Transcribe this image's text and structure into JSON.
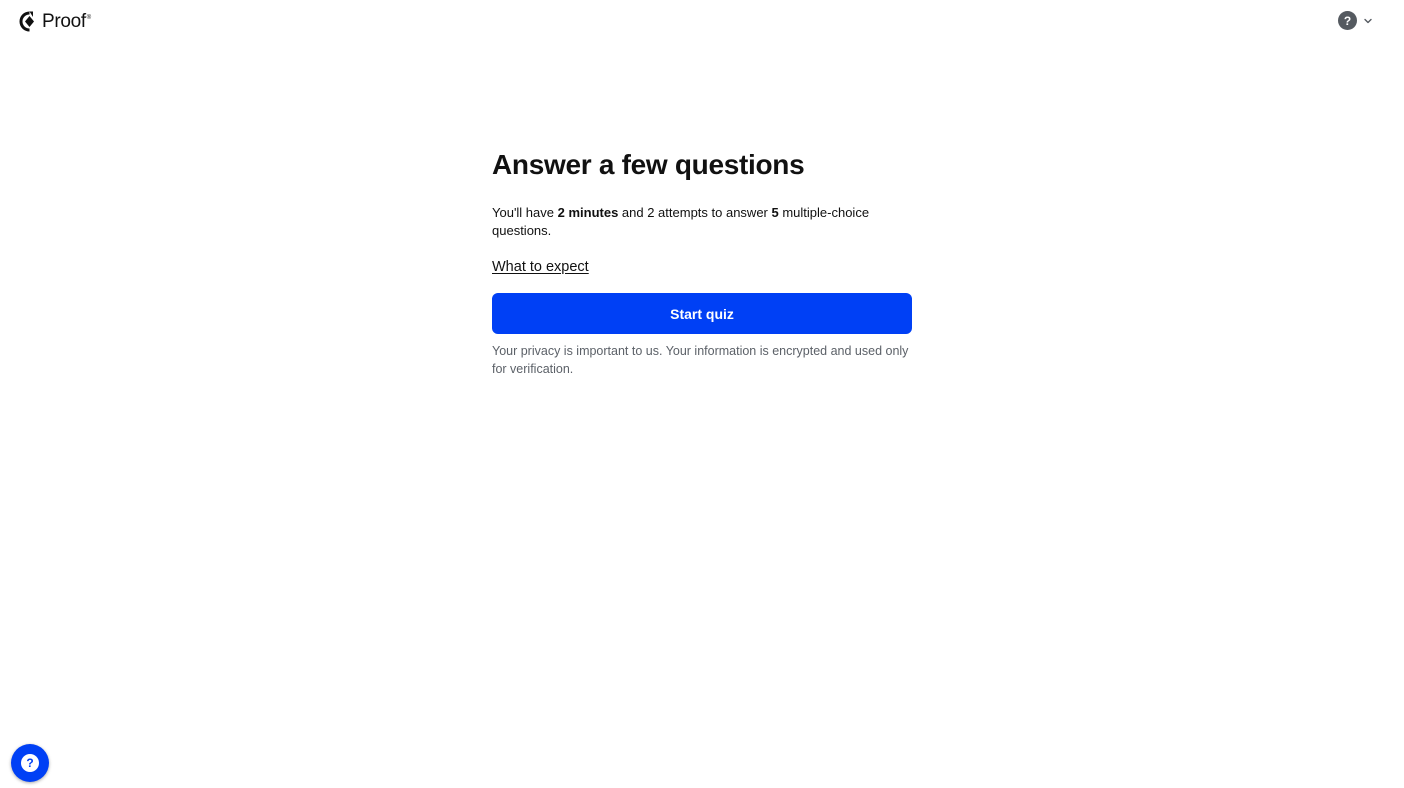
{
  "header": {
    "logo_text": "Proof",
    "logo_trademark": "®",
    "help_glyph": "?",
    "icons": {
      "logo": "proof-logo-icon",
      "help": "question-circle-icon",
      "dropdown": "chevron-down-icon"
    }
  },
  "main": {
    "title": "Answer a few questions",
    "description": {
      "part1": "You'll have ",
      "bold1": "2 minutes",
      "part2": " and 2 attempts to answer ",
      "bold2": "5",
      "part3": " multiple-choice questions."
    },
    "expect_link": "What to expect",
    "start_button": "Start quiz",
    "privacy_note": "Your privacy is important to us. Your information is encrypted and used only for verification."
  },
  "support": {
    "glyph": "?",
    "icon": "question-circle-icon"
  },
  "colors": {
    "accent": "#0040f5",
    "text": "#111111",
    "muted": "#5c6168",
    "help_icon_bg": "#555a60"
  }
}
